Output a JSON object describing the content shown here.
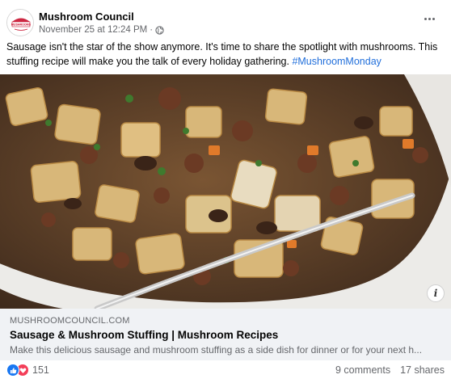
{
  "post": {
    "author": "Mushroom Council",
    "timestamp": "November 25 at 12:24 PM",
    "separator": "·",
    "audience_icon": "globe-icon",
    "avatar_logo_text": "Fresh MUSHROOMS",
    "text": "Sausage isn't the star of the show anymore. It's time to share the spotlight with mushrooms. This stuffing recipe will make you the talk of every holiday gathering. ",
    "hashtag": "#MushroomMonday",
    "more_icon": "more-options-icon"
  },
  "image": {
    "description_icon": "info-icon",
    "info_label": "i"
  },
  "link": {
    "domain": "MUSHROOMCOUNCIL.COM",
    "title": "Sausage & Mushroom Stuffing | Mushroom Recipes",
    "description": "Make this delicious sausage and mushroom stuffing as a side dish for dinner or for your next h..."
  },
  "footer": {
    "reaction_icons": [
      "like-icon",
      "love-icon"
    ],
    "reaction_count": "151",
    "comments": "9 comments",
    "shares": "17 shares"
  },
  "colors": {
    "like": "#1877f2",
    "love": "#f33e58",
    "hashtag": "#216fdb",
    "secondary_text": "#65676b",
    "link_bg": "#f0f2f5"
  }
}
